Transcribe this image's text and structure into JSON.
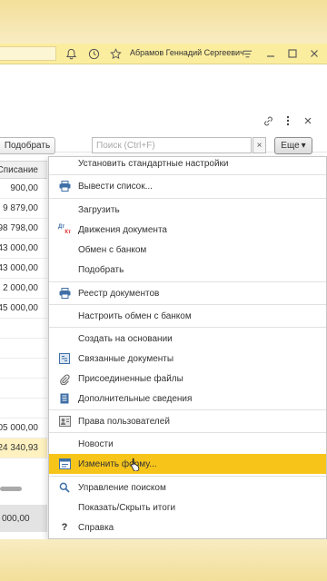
{
  "titlebar": {
    "user_name": "Абрамов Геннадий Сергеевич"
  },
  "toolbar": {
    "pick_label": "Подобрать",
    "search_placeholder": "Поиск (Ctrl+F)",
    "search_clear": "×",
    "more_label": "Еще",
    "more_arrow": "▾"
  },
  "table": {
    "column_header": "Списание",
    "rows": [
      "900,00",
      "9 879,00",
      "98 798,00",
      "43 000,00",
      "43 000,00",
      "2 000,00",
      "45 000,00",
      "",
      "",
      "",
      "",
      "",
      "05 000,00",
      "24 340,93"
    ],
    "total": "000,00"
  },
  "menu": {
    "items": [
      "Установить стандартные настройки",
      "Вывести список...",
      "Загрузить",
      "Движения документа",
      "Обмен с банком",
      "Подобрать",
      "Реестр документов",
      "Настроить обмен с банком",
      "Создать на основании",
      "Связанные документы",
      "Присоединенные файлы",
      "Дополнительные сведения",
      "Права пользователей",
      "Новости",
      "Изменить форму...",
      "Управление поиском",
      "Показать/Скрыть итоги",
      "Справка"
    ],
    "dt_kt_top": "Дт",
    "dt_kt_bottom": "Кт",
    "help_glyph": "?"
  },
  "colors": {
    "highlight": "#f7c51a",
    "titlebar": "#fbed9e",
    "icon_blue": "#3f6fa6"
  }
}
